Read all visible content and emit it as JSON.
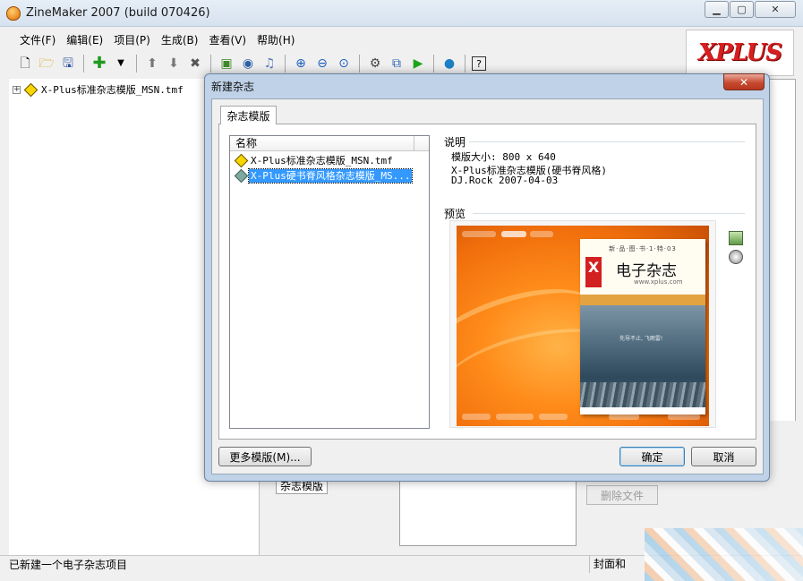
{
  "window": {
    "title": "ZineMaker 2007 (build 070426)",
    "min_glyph": "▁",
    "max_glyph": "▢",
    "close_glyph": "✕"
  },
  "menu": [
    {
      "label": "文件(F)"
    },
    {
      "label": "编辑(E)"
    },
    {
      "label": "项目(P)"
    },
    {
      "label": "生成(B)"
    },
    {
      "label": "查看(V)"
    },
    {
      "label": "帮助(H)"
    }
  ],
  "toolbar_icons": [
    "new-file-icon",
    "open-folder-icon",
    "save-icon",
    "add-icon",
    "dropdown-arrow-icon",
    "move-up-icon",
    "move-down-icon",
    "delete-icon",
    "image-icon",
    "compass-icon",
    "music-icon",
    "zoom-in-icon",
    "zoom-out-icon",
    "zoom-fit-icon",
    "settings-icon",
    "build-icon",
    "play-icon",
    "globe-icon",
    "help-icon"
  ],
  "logo": {
    "text": "XPLUS"
  },
  "tree": {
    "items": [
      {
        "label": "X-Plus标准杂志模版_MSN.tmf",
        "expander": "+"
      }
    ]
  },
  "background_panel": {
    "tab_label": "杂志模版",
    "button_label": "删除文件"
  },
  "status": {
    "left": "已新建一个电子杂志项目",
    "right": "封面和"
  },
  "dialog": {
    "title": "新建杂志",
    "close_glyph": "✕",
    "tab_label": "杂志模版",
    "list": {
      "column_header": "名称",
      "items": [
        {
          "label": "X-Plus标准杂志模版_MSN.tmf",
          "selected": false
        },
        {
          "label": "X-Plus硬书脊风格杂志模版_MS...",
          "selected": true
        }
      ]
    },
    "info": {
      "group_title": "说明",
      "size_line": "模版大小: 800 x 640",
      "name_line": "X-Plus标准杂志模版(硬书脊风格)",
      "author_line": "DJ.Rock 2007-04-03"
    },
    "preview": {
      "group_title": "预览",
      "cover_nav": "新·品·图·书·1·特·03",
      "cover_logo": "X",
      "cover_title": "电子杂志",
      "cover_url": "www.xplus.com",
      "cover_caption": "先导不止, 飞雨雷!"
    },
    "buttons": {
      "more": "更多模版(M)...",
      "ok": "确定",
      "cancel": "取消"
    }
  }
}
